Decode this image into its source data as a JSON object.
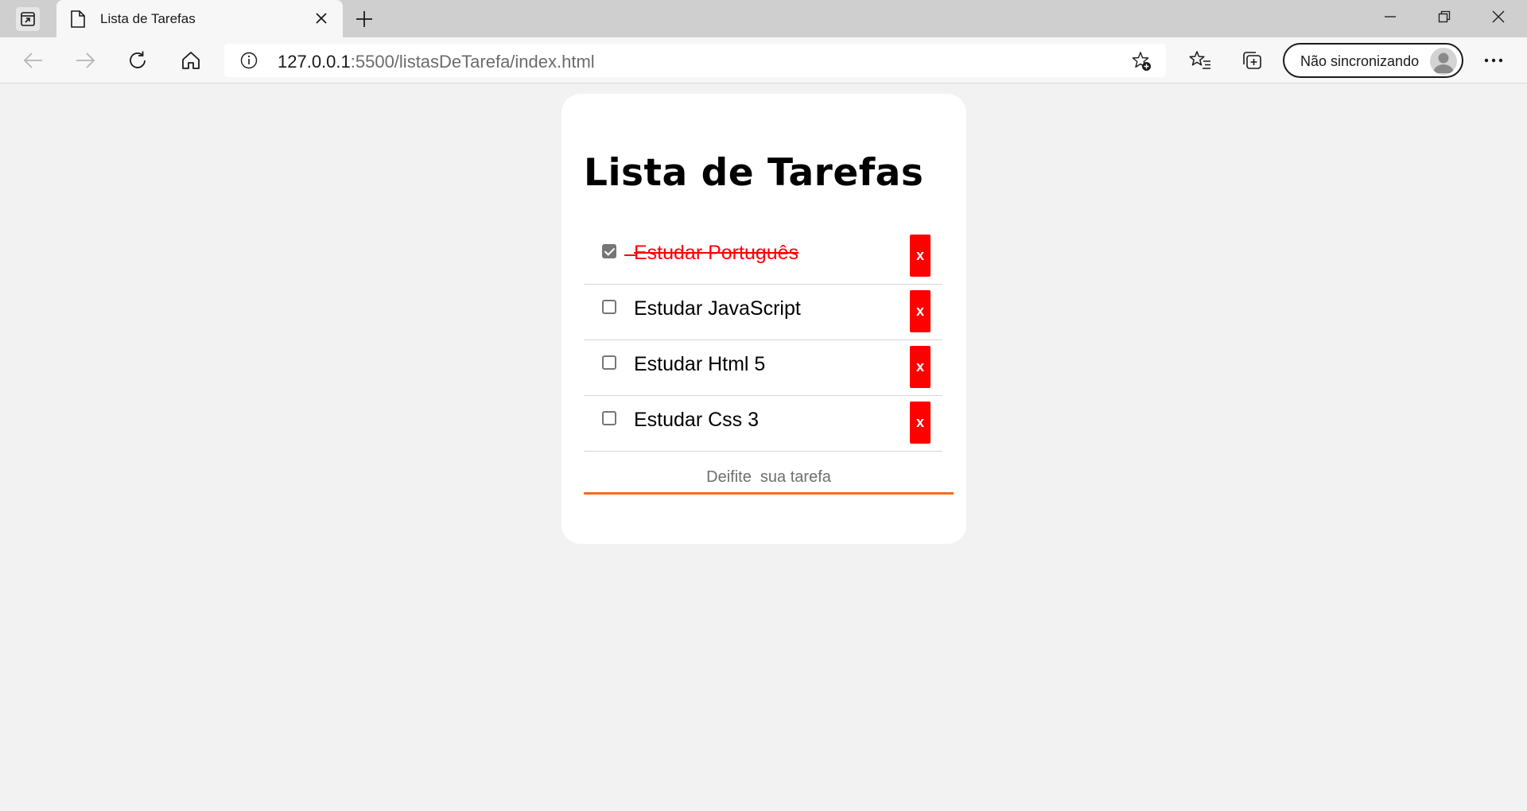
{
  "browser": {
    "tab_title": "Lista de Tarefas",
    "url_host": "127.0.0.1",
    "url_rest": ":5500/listasDeTarefa/index.html",
    "profile_label": "Não sincronizando"
  },
  "page": {
    "title": "Lista de Tarefas",
    "tasks": [
      {
        "label": "Estudar Português",
        "done": true,
        "delete_label": "x"
      },
      {
        "label": "Estudar JavaScript",
        "done": false,
        "delete_label": "x"
      },
      {
        "label": "Estudar Html 5",
        "done": false,
        "delete_label": "x"
      },
      {
        "label": "Estudar Css 3",
        "done": false,
        "delete_label": "x"
      }
    ],
    "input_placeholder": "Deifite  sua tarefa",
    "colors": {
      "accent": "#ff6a1a",
      "delete": "#ff0000",
      "done_text": "#ff0000"
    }
  }
}
